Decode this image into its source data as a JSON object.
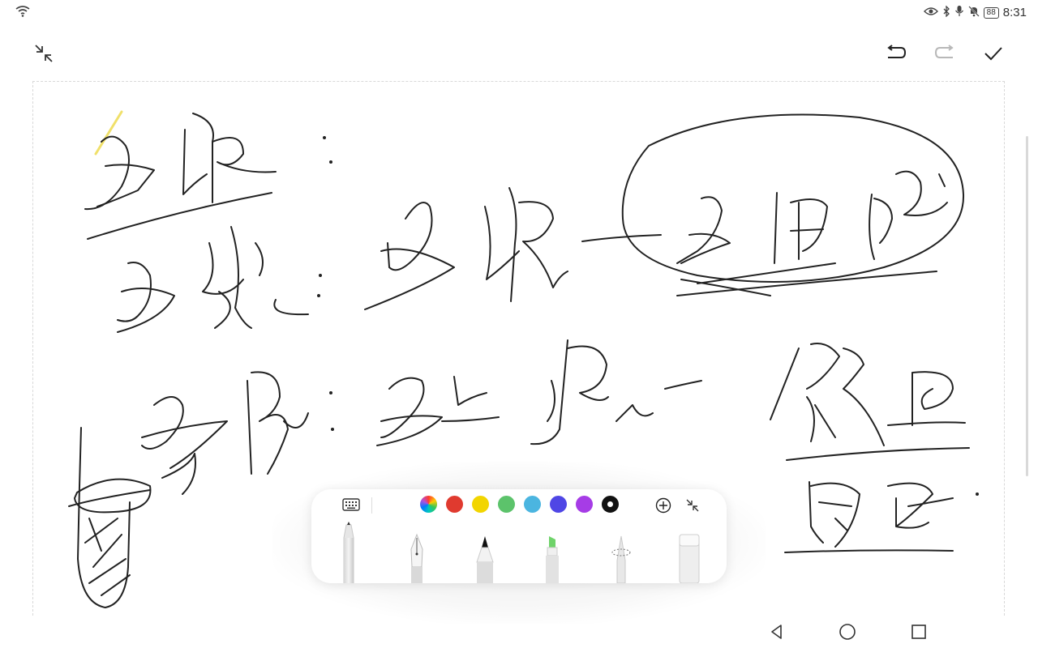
{
  "status_bar": {
    "battery_level": "88",
    "time": "8:31",
    "icons": [
      "wifi-icon",
      "eye-icon",
      "bluetooth-icon",
      "microphone-icon",
      "bell-off-icon",
      "battery-icon"
    ]
  },
  "header": {
    "left_icon": "collapse-icon",
    "right_icons": [
      "undo-icon",
      "redo-icon",
      "check-icon"
    ],
    "redo_enabled": false
  },
  "toolbar": {
    "colors": [
      "#e03a2f",
      "#f2d500",
      "#5cc36b",
      "#4bb5e0",
      "#4f46e5",
      "#a63ce6",
      "#111111"
    ],
    "selected_color": "#111111",
    "tools": [
      "ballpoint-pen",
      "fountain-pen",
      "pencil",
      "highlighter",
      "lasso",
      "eraser"
    ],
    "active_tool": "ballpoint-pen",
    "highlighter_color": "#6fd36a"
  },
  "nav_bar": {
    "icons": [
      "back-triangle-icon",
      "home-circle-icon",
      "recents-square-icon"
    ]
  }
}
